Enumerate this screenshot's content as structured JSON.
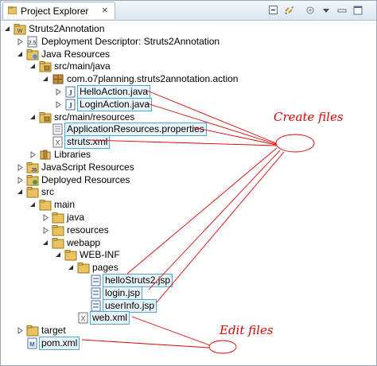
{
  "window": {
    "title": "Project Explorer",
    "toolbar_icons": [
      "collapse-all-icon",
      "link-with-editor-icon",
      "focus-icon",
      "view-menu-icon",
      "minimize-icon",
      "maximize-icon"
    ]
  },
  "tree": [
    {
      "label": "Struts2Annotation",
      "level": 0,
      "toggle": "open",
      "icon": "project-icon"
    },
    {
      "label": "Deployment Descriptor: Struts2Annotation",
      "level": 1,
      "toggle": "closed",
      "icon": "descriptor-icon"
    },
    {
      "label": "Java Resources",
      "level": 1,
      "toggle": "open",
      "icon": "java-resources-icon"
    },
    {
      "label": "src/main/java",
      "level": 2,
      "toggle": "open",
      "icon": "source-folder-icon"
    },
    {
      "label": "com.o7planning.struts2annotation.action",
      "level": 3,
      "toggle": "open",
      "icon": "package-icon"
    },
    {
      "label": "HelloAction.java",
      "level": 4,
      "toggle": "closed",
      "icon": "java-file-icon",
      "highlight": true
    },
    {
      "label": "LoginAction.java",
      "level": 4,
      "toggle": "closed",
      "icon": "java-file-icon",
      "highlight": true
    },
    {
      "label": "src/main/resources",
      "level": 2,
      "toggle": "open",
      "icon": "source-folder-icon"
    },
    {
      "label": "ApplicationResources.properties",
      "level": 3,
      "toggle": "none",
      "icon": "properties-file-icon",
      "highlight": true
    },
    {
      "label": "struts.xml",
      "level": 3,
      "toggle": "none",
      "icon": "xml-file-icon",
      "highlight": true
    },
    {
      "label": "Libraries",
      "level": 2,
      "toggle": "closed",
      "icon": "libraries-icon"
    },
    {
      "label": "JavaScript Resources",
      "level": 1,
      "toggle": "closed",
      "icon": "javascript-resources-icon"
    },
    {
      "label": "Deployed Resources",
      "level": 1,
      "toggle": "closed",
      "icon": "deployed-resources-icon"
    },
    {
      "label": "src",
      "level": 1,
      "toggle": "open",
      "icon": "folder-icon"
    },
    {
      "label": "main",
      "level": 2,
      "toggle": "open",
      "icon": "folder-icon"
    },
    {
      "label": "java",
      "level": 3,
      "toggle": "closed",
      "icon": "folder-icon"
    },
    {
      "label": "resources",
      "level": 3,
      "toggle": "closed",
      "icon": "folder-icon"
    },
    {
      "label": "webapp",
      "level": 3,
      "toggle": "open",
      "icon": "folder-icon"
    },
    {
      "label": "WEB-INF",
      "level": 4,
      "toggle": "open",
      "icon": "folder-icon"
    },
    {
      "label": "pages",
      "level": 5,
      "toggle": "open",
      "icon": "folder-icon"
    },
    {
      "label": "helloStruts2.jsp",
      "level": 6,
      "toggle": "none",
      "icon": "jsp-file-icon",
      "highlight": true
    },
    {
      "label": "login.jsp",
      "level": 6,
      "toggle": "none",
      "icon": "jsp-file-icon",
      "highlight": true
    },
    {
      "label": "userInfo.jsp",
      "level": 6,
      "toggle": "none",
      "icon": "jsp-file-icon",
      "highlight": true
    },
    {
      "label": "web.xml",
      "level": 5,
      "toggle": "none",
      "icon": "xml-file-icon",
      "highlight": true
    },
    {
      "label": "target",
      "level": 1,
      "toggle": "closed",
      "icon": "folder-icon"
    },
    {
      "label": "pom.xml",
      "level": 1,
      "toggle": "none",
      "icon": "maven-file-icon",
      "highlight": true
    }
  ],
  "annotations": {
    "create_label": "Create files",
    "edit_label": "Edit files",
    "color": "#e00000"
  }
}
